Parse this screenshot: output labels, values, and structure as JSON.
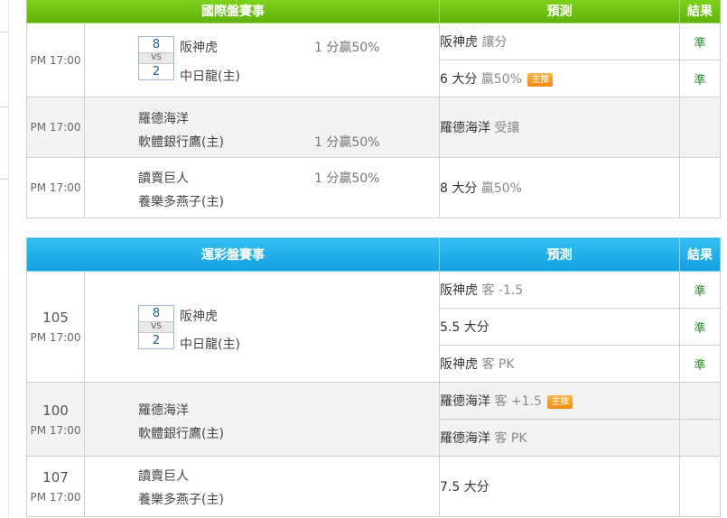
{
  "intl": {
    "header": {
      "matches": "國際盤賽事",
      "prediction": "預測",
      "result": "結果"
    },
    "games": [
      {
        "time": "PM 17:00",
        "home": "阪神虎",
        "away": "中日龍(主)",
        "score_home": "8",
        "vs": "VS",
        "score_away": "2",
        "odds": "1 分贏50%",
        "predictions": [
          {
            "main": "阪神虎",
            "detail": "讓分",
            "badge": "",
            "result": "準"
          },
          {
            "main": "6 大分",
            "detail": "贏50%",
            "badge": "主推",
            "result": "準"
          }
        ]
      },
      {
        "time": "PM 17:00",
        "home": "羅德海洋",
        "away": "軟體銀行鷹(主)",
        "odds": "1 分贏50%",
        "predictions": [
          {
            "main": "羅德海洋",
            "detail": "受讓",
            "badge": "",
            "result": ""
          }
        ]
      },
      {
        "time": "PM 17:00",
        "home": "讀賣巨人",
        "away": "養樂多燕子(主)",
        "odds": "1 分贏50%",
        "predictions": [
          {
            "main": "8 大分",
            "detail": "贏50%",
            "badge": "",
            "result": ""
          }
        ]
      }
    ]
  },
  "local": {
    "header": {
      "matches": "運彩盤賽事",
      "prediction": "預測",
      "result": "結果"
    },
    "games": [
      {
        "num": "105",
        "time": "PM 17:00",
        "home": "阪神虎",
        "away": "中日龍(主)",
        "score_home": "8",
        "vs": "VS",
        "score_away": "2",
        "predictions": [
          {
            "main": "阪神虎",
            "detail": "客 -1.5",
            "badge": "",
            "result": "準"
          },
          {
            "main": "5.5 大分",
            "detail": "",
            "badge": "",
            "result": "準"
          },
          {
            "main": "阪神虎",
            "detail": "客 PK",
            "badge": "",
            "result": "準"
          }
        ]
      },
      {
        "num": "100",
        "time": "PM 17:00",
        "home": "羅德海洋",
        "away": "軟體銀行鷹(主)",
        "predictions": [
          {
            "main": "羅德海洋",
            "detail": "客 +1.5",
            "badge": "主推",
            "result": ""
          },
          {
            "main": "羅德海洋",
            "detail": "客 PK",
            "badge": "",
            "result": ""
          }
        ]
      },
      {
        "num": "107",
        "time": "PM 17:00",
        "home": "讀賣巨人",
        "away": "養樂多燕子(主)",
        "predictions": [
          {
            "main": "7.5 大分",
            "detail": "",
            "badge": "",
            "result": ""
          }
        ]
      }
    ]
  }
}
